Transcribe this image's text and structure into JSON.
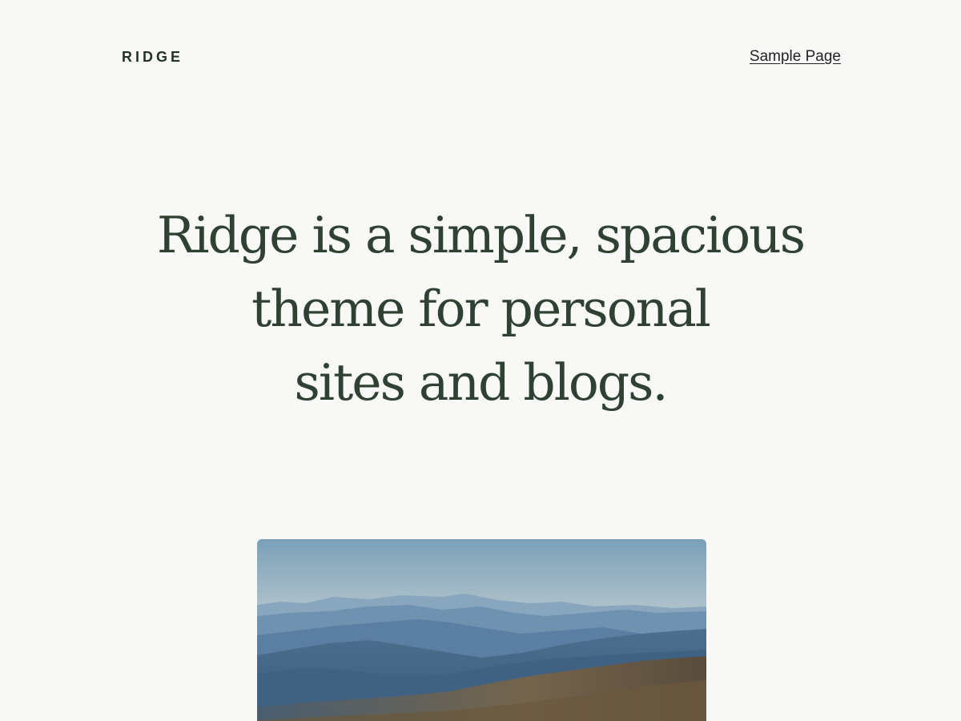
{
  "header": {
    "site_title": "RIDGE",
    "nav": [
      {
        "label": "Sample Page"
      }
    ]
  },
  "hero": {
    "heading_lines": [
      "Ridge is a simple, spacious",
      "theme for personal",
      "sites and blogs."
    ]
  },
  "featured_image": {
    "subject": "mountain-ridges-landscape",
    "colors": {
      "sky_top": "#7aa0b8",
      "sky_bottom": "#e6e4d8",
      "ridge_far": "#6e92b0",
      "ridge_mid": "#4f7599",
      "ridge_near": "#3c5f82",
      "foreground": "#6b5a3e"
    }
  }
}
